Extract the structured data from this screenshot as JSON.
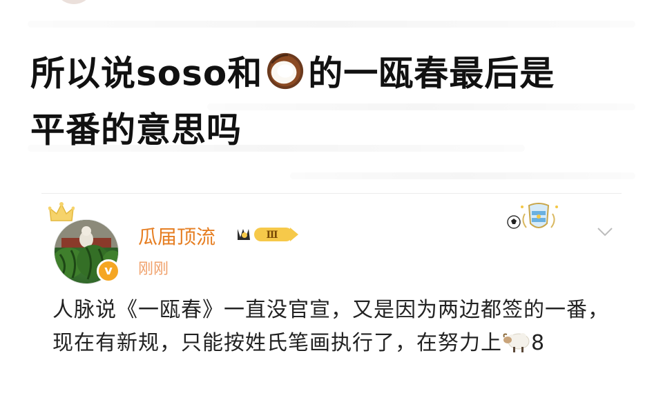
{
  "question": {
    "part1": "所以说soso和",
    "part2": "的一瓯春最后是",
    "part3": "平番的意思吗",
    "inline_emoji": "coconut-icon"
  },
  "post": {
    "username": "瓜届顶流",
    "vip_level": "Ⅲ",
    "timestamp": "刚刚",
    "body_part1": "人脉说《一瓯春》一直没官宣，又是因为两边都签的一番，现在有新规，只能按姓氏笔画执行了，在努力上",
    "body_part2": "8",
    "inline_emoji": "sheep-icon"
  },
  "colors": {
    "username": "#e67e22",
    "timestamp": "#f0a06a",
    "title": "#111111",
    "body": "#222222",
    "verified_badge": "#f5a623"
  }
}
